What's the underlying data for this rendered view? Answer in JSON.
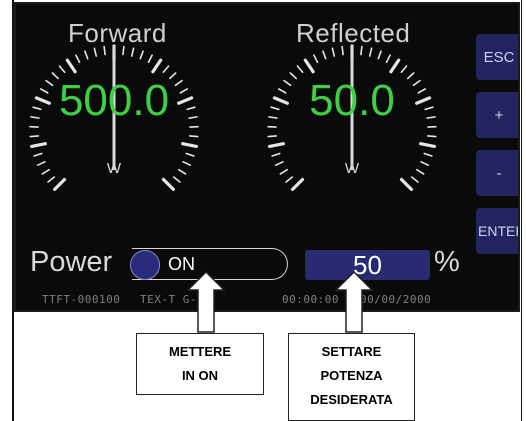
{
  "gauges": {
    "forward": {
      "title": "Forward",
      "value": "500.0",
      "unit": "W",
      "needle_fraction": 0.5
    },
    "reflected": {
      "title": "Reflected",
      "value": "50.0",
      "unit": "W",
      "needle_fraction": 0.5
    }
  },
  "side_buttons": {
    "esc": "ESC",
    "plus": "+",
    "minus": "-",
    "enter": "ENTER"
  },
  "power": {
    "label": "Power",
    "toggle_state": "ON",
    "setpoint": "50",
    "unit": "%"
  },
  "status_bar": {
    "device_id": "TTFT-000100",
    "model": "TEX-T G-01",
    "time": "00:00:00",
    "date": "00/00/2000"
  },
  "callouts": {
    "toggle_note": [
      "METTERE",
      "IN ON"
    ],
    "setpoint_note": [
      "SETTARE",
      "POTENZA",
      "DESIDERATA"
    ]
  },
  "colors": {
    "value_green": "#3ecf45",
    "button_navy": "#23235f",
    "screen_bg": "#0a0a0a"
  }
}
